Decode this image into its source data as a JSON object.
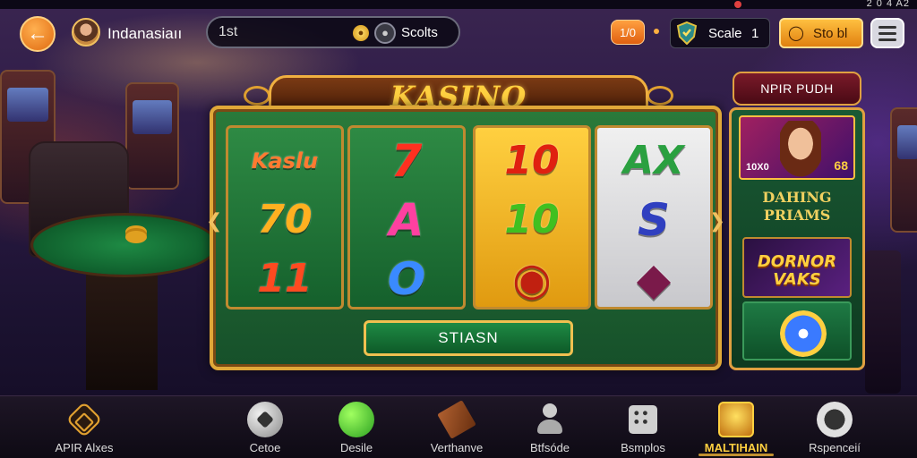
{
  "status_bar": {
    "right_text": "2 0 4 A2"
  },
  "header": {
    "player_name": "Indanasiaıı",
    "search_value": "1st",
    "currency_label": "Scolts",
    "level_badge": "1/0",
    "scale_label": "Scale",
    "scale_value": "1",
    "gold_button_label": "Sto bl",
    "gold_button_icon": "coin-icon"
  },
  "slot": {
    "title": "KASINO",
    "spin_button_label": "STIASN",
    "reels": [
      {
        "style": "green",
        "symbols": [
          {
            "text": "Kaslu",
            "color": "#ff7a30"
          },
          {
            "text": "70",
            "color": "#ffb020"
          },
          {
            "text": "11",
            "color": "#ff4a20"
          }
        ]
      },
      {
        "style": "green",
        "symbols": [
          {
            "text": "7",
            "color": "#ff3020"
          },
          {
            "text": "A",
            "color": "#ff40a0"
          },
          {
            "text": "O",
            "color": "#3a8aff"
          }
        ]
      },
      {
        "style": "gold",
        "symbols": [
          {
            "text": "10",
            "color": "#e02010"
          },
          {
            "text": "10",
            "color": "#40c020"
          },
          {
            "text": "◉",
            "color": "#c02010"
          }
        ]
      },
      {
        "style": "white",
        "symbols": [
          {
            "text": "AX",
            "color": "#2aa040"
          },
          {
            "text": "S",
            "color": "#3040c0"
          },
          {
            "text": "◆",
            "color": "#7a1a4a"
          }
        ]
      }
    ]
  },
  "promo": {
    "header": "NPIR PUDH",
    "card1_left_text": "10X0",
    "card1_right_text": "68",
    "title_line1": "DAHING",
    "title_line2": "PRIAMS",
    "card2_line1": "DORNOR",
    "card2_line2": "VAKS"
  },
  "bottom_nav": {
    "items": [
      {
        "label": "APIR Alxes",
        "icon": "home-icon"
      },
      {
        "label": "Cetoe",
        "icon": "ball-icon"
      },
      {
        "label": "Desile",
        "icon": "green-orb-icon"
      },
      {
        "label": "Verthanve",
        "icon": "box-icon"
      },
      {
        "label": "Btfsóde",
        "icon": "person-icon"
      },
      {
        "label": "Bsmplos",
        "icon": "dice-icon"
      },
      {
        "label": "MALTIHAIN",
        "icon": "trophy-icon"
      },
      {
        "label": "Rspenceií",
        "icon": "ring-icon"
      }
    ]
  }
}
